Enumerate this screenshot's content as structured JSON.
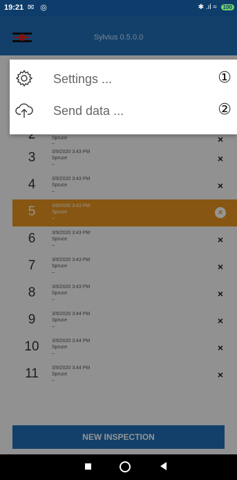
{
  "status_bar": {
    "time": "19:21",
    "left_icons": "✉ ◎",
    "right_icons": "✱ .ıl ≈",
    "battery": "100"
  },
  "app_bar": {
    "title": "Sylvius 0.5.0.0"
  },
  "menu": {
    "items": [
      {
        "label": "Settings ...",
        "marker": "①",
        "icon": "gear-icon"
      },
      {
        "label": "Send data ...",
        "marker": "②",
        "icon": "cloud-upload-icon"
      }
    ]
  },
  "list": {
    "rows": [
      {
        "num": "2",
        "date": "",
        "species": "Spruce",
        "dash": "–",
        "delete": "×"
      },
      {
        "num": "3",
        "date": "3/9/2020 3:43 PM",
        "species": "Spruce",
        "dash": "–",
        "delete": "×"
      },
      {
        "num": "4",
        "date": "3/9/2020 3:43 PM",
        "species": "Spruce",
        "dash": "–",
        "delete": "×"
      },
      {
        "num": "5",
        "date": "3/9/2020 3:43 PM",
        "species": "Spruce",
        "dash": "–",
        "delete": "×"
      },
      {
        "num": "6",
        "date": "3/9/2020 3:43 PM",
        "species": "Spruce",
        "dash": "–",
        "delete": "×"
      },
      {
        "num": "7",
        "date": "3/9/2020 3:43 PM",
        "species": "Spruce",
        "dash": "–",
        "delete": "×"
      },
      {
        "num": "8",
        "date": "3/9/2020 3:43 PM",
        "species": "Spruce",
        "dash": "–",
        "delete": "×"
      },
      {
        "num": "9",
        "date": "3/9/2020 3:44 PM",
        "species": "Spruce",
        "dash": "–",
        "delete": "×"
      },
      {
        "num": "10",
        "date": "3/9/2020 3:44 PM",
        "species": "Spruce",
        "dash": "–",
        "delete": "×"
      },
      {
        "num": "11",
        "date": "3/9/2020 3:44 PM",
        "species": "Spruce",
        "dash": "–",
        "delete": "×"
      }
    ]
  },
  "new_inspection_label": "NEW INSPECTION",
  "colors": {
    "app_bar": "#1f6fb9",
    "status_bar": "#0e3d6b",
    "highlight": "#e8941f",
    "logo_red": "#e2231a"
  }
}
